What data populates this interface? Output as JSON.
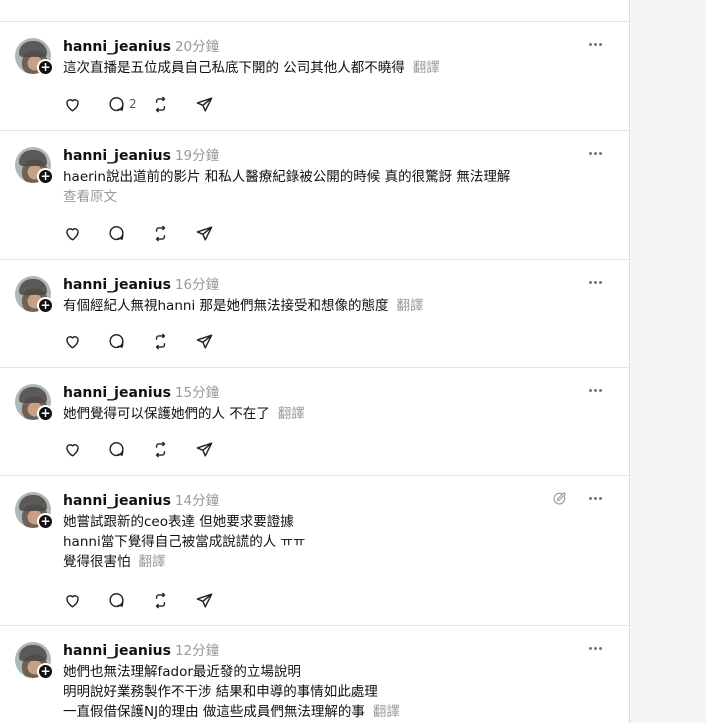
{
  "feed": {
    "posts": [
      {
        "username": "hanni_jeanius",
        "time": "20分鐘",
        "lines": [
          "這次直播是五位成員自己私底下開的 公司其他人都不曉得"
        ],
        "translate": "翻譯",
        "reply_count": "2"
      },
      {
        "username": "hanni_jeanius",
        "time": "19分鐘",
        "lines": [
          "haerin說出道前的影片 和私人醫療紀錄被公開的時候 真的很驚訝 無法理解"
        ],
        "see_original": "查看原文"
      },
      {
        "username": "hanni_jeanius",
        "time": "16分鐘",
        "lines": [
          "有個經紀人無視hanni 那是她們無法接受和想像的態度"
        ],
        "translate": "翻譯"
      },
      {
        "username": "hanni_jeanius",
        "time": "15分鐘",
        "lines": [
          "她們覺得可以保護她們的人 不在了"
        ],
        "translate": "翻譯"
      },
      {
        "username": "hanni_jeanius",
        "time": "14分鐘",
        "lines": [
          "她嘗試跟新的ceo表達 但她要求要證據",
          "hanni當下覺得自己被當成說謊的人 ㅠㅠ",
          "覺得很害怕"
        ],
        "translate": "翻譯"
      },
      {
        "username": "hanni_jeanius",
        "time": "12分鐘",
        "lines": [
          "她們也無法理解fador最近發的立場說明",
          "明明說好業務製作不干涉 結果和申導的事情如此處理",
          "一直假借保護NJ的理由 做這些成員們無法理解的事"
        ],
        "translate": "翻譯"
      }
    ]
  },
  "icons": {
    "like": "heart-icon",
    "reply": "comment-icon",
    "repost": "repost-icon",
    "share": "send-icon",
    "more": "more-icon",
    "edit": "edit-icon"
  },
  "colors": {
    "text": "#111111",
    "muted": "#999999",
    "divider": "#e3e3e3",
    "page_bg": "#f5f5f5"
  }
}
